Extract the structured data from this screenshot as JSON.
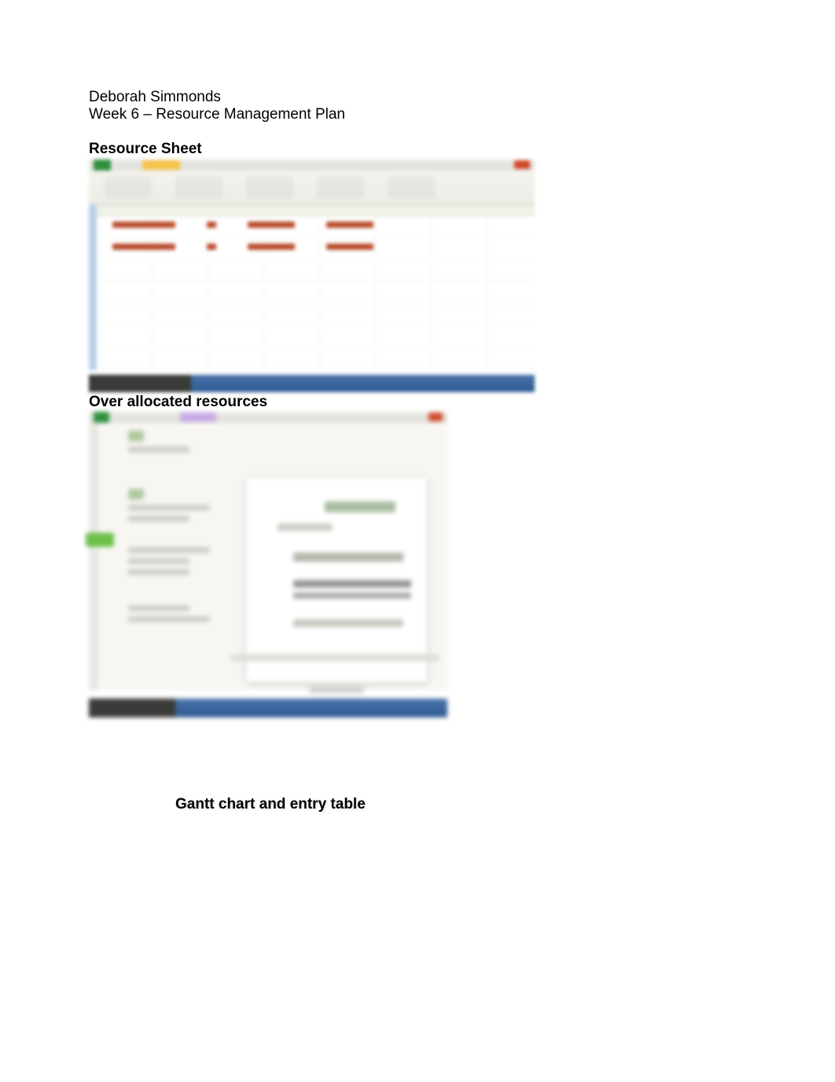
{
  "header": {
    "author": "Deborah Simmonds",
    "subtitle": "Week 6 – Resource Management Plan"
  },
  "sections": {
    "resource_sheet": "Resource Sheet",
    "over_allocated": "Over allocated resources",
    "gantt": "Gantt chart and entry table"
  }
}
